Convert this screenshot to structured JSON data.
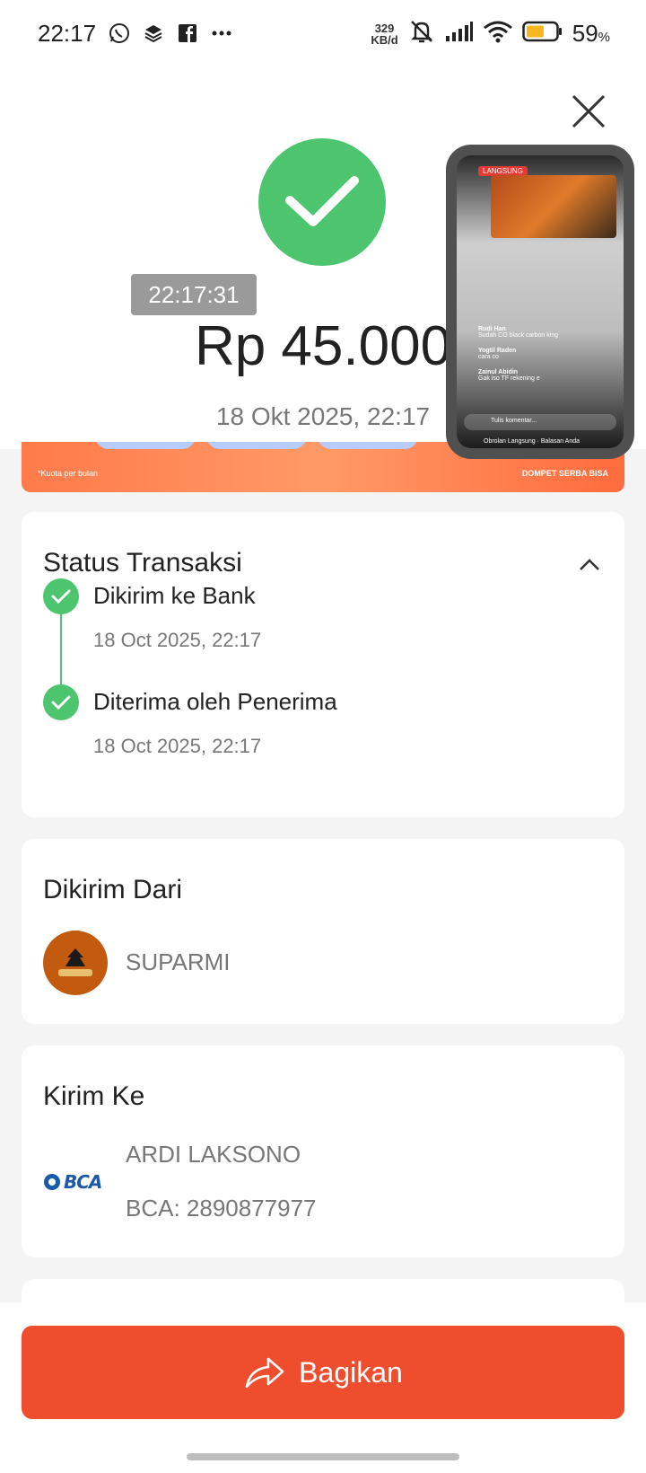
{
  "status_bar": {
    "time": "22:17",
    "net_speed_value": "329",
    "net_speed_unit": "KB/d",
    "battery_value": "59",
    "battery_unit": "%",
    "battery_level": 0.59,
    "icons": [
      "whatsapp-icon",
      "layers-icon",
      "facebook-icon",
      "more-dots-icon",
      "mute-bell-icon",
      "signal-icon",
      "wifi-icon",
      "battery-icon"
    ]
  },
  "header": {
    "time_badge": "22:17:31",
    "amount": "Rp 45.000",
    "date": "18 Okt 2025, 22:17"
  },
  "promo": {
    "note": "*Kuota per bulan",
    "brand": "DOMPET SERBA BISA"
  },
  "pip_video": {
    "live_badge": "LANGSUNG",
    "comments": [
      {
        "name": "Rudi Han",
        "text": "Sudah CO black carbon king"
      },
      {
        "name": "Yogtil Raden",
        "text": "cara co"
      },
      {
        "name": "Zainul Abidin",
        "text": "Gak iso TF rekening e"
      }
    ],
    "comment_placeholder": "Tulis komentar...",
    "footer": "Obrolan Langsung · Balasan Anda"
  },
  "status_section": {
    "title": "Status Transaksi",
    "steps": [
      {
        "label": "Dikirim ke Bank",
        "date": "18 Oct 2025, 22:17"
      },
      {
        "label": "Diterima oleh Penerima",
        "date": "18 Oct 2025, 22:17"
      }
    ]
  },
  "from_section": {
    "title": "Dikirim Dari",
    "name": "SUPARMI"
  },
  "to_section": {
    "title": "Kirim Ke",
    "name": "ARDI LAKSONO",
    "account": "BCA: 2890877977",
    "bank_logo_text": "BCA"
  },
  "share_button": {
    "label": "Bagikan"
  },
  "colors": {
    "success": "#4cc56e",
    "accent": "#ef4e2e",
    "badge_gray": "#9a9a9a"
  }
}
